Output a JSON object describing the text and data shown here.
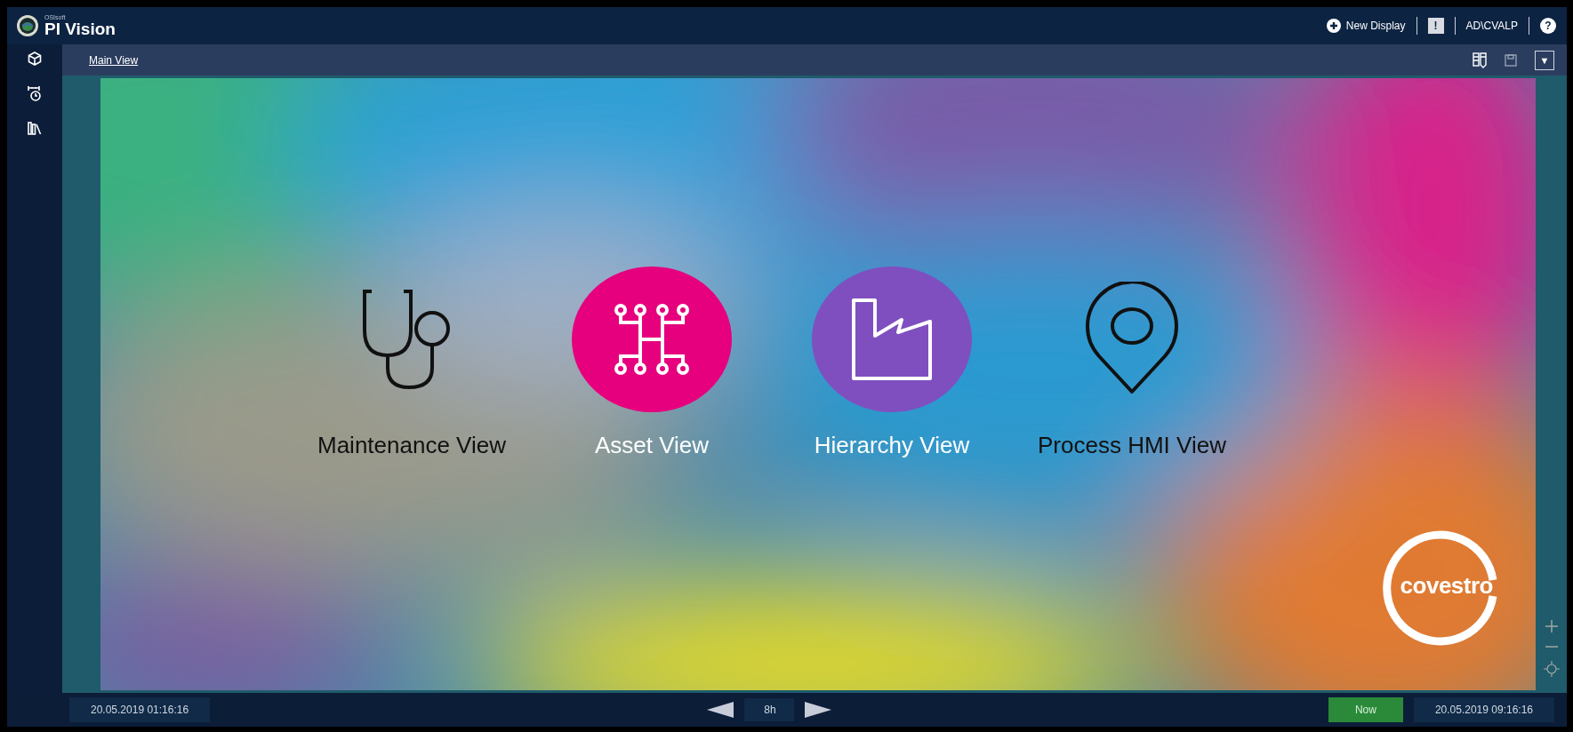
{
  "header": {
    "vendor": "OSIsoft",
    "title": "PI Vision",
    "new_display": "New Display",
    "alert": "!",
    "user": "AD\\CVALP",
    "help": "?"
  },
  "toolbar": {
    "breadcrumb": "Main View",
    "menu_caret": "▼"
  },
  "tiles": [
    {
      "kind": "stethoscope",
      "label": "Maintenance View"
    },
    {
      "kind": "circuit",
      "label": "Asset View",
      "color": "#e6007e"
    },
    {
      "kind": "factory",
      "label": "Hierarchy View",
      "color": "#7f4fc0"
    },
    {
      "kind": "pin",
      "label": "Process HMI View"
    }
  ],
  "logo": {
    "text": "covestro"
  },
  "time_bar": {
    "start": "20.05.2019 01:16:16",
    "duration": "8h",
    "now": "Now",
    "end": "20.05.2019 09:16:16"
  }
}
